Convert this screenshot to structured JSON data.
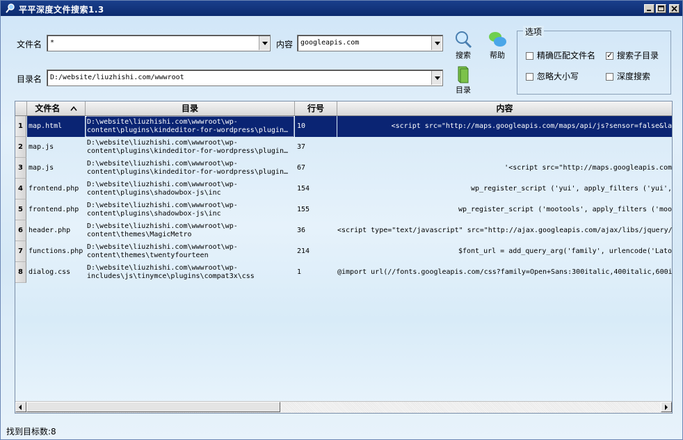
{
  "window": {
    "title": "平平深度文件搜索1.3"
  },
  "form": {
    "filename_label": "文件名",
    "filename_value": "*",
    "content_label": "内容",
    "content_value": "googleapis.com",
    "dir_label": "目录名",
    "dir_value": "D:/website/liuzhishi.com/wwwroot"
  },
  "toolbar": {
    "search_label": "搜索",
    "help_label": "帮助",
    "dir_label": "目录"
  },
  "options": {
    "title": "选项",
    "exact_match": {
      "label": "精确匹配文件名",
      "checked": false
    },
    "subdirs": {
      "label": "搜索子目录",
      "checked": true
    },
    "ignore_case": {
      "label": "忽略大小写",
      "checked": false
    },
    "deep_search": {
      "label": "深度搜索",
      "checked": false
    }
  },
  "table": {
    "columns": [
      "文件名",
      "目录",
      "行号",
      "内容"
    ],
    "rows": [
      {
        "num": "1",
        "name": "map.html",
        "dir1": "D:\\website\\liuzhishi.com\\wwwroot\\wp-",
        "dir2": "content\\plugins\\kindeditor-for-wordpress\\plugin…",
        "line": "10",
        "content": "<script src=\"http://maps.googleapis.com/maps/api/js?sensor=false&la",
        "selected": true
      },
      {
        "num": "2",
        "name": "map.js",
        "dir1": "D:\\website\\liuzhishi.com\\wwwroot\\wp-",
        "dir2": "content\\plugins\\kindeditor-for-wordpress\\plugin…",
        "line": "37",
        "content": "",
        "selected": false
      },
      {
        "num": "3",
        "name": "map.js",
        "dir1": "D:\\website\\liuzhishi.com\\wwwroot\\wp-",
        "dir2": "content\\plugins\\kindeditor-for-wordpress\\plugin…",
        "line": "67",
        "content": "'<script src=\"http://maps.googleapis.com",
        "selected": false
      },
      {
        "num": "4",
        "name": "frontend.php",
        "dir1": "D:\\website\\liuzhishi.com\\wwwroot\\wp-",
        "dir2": "content\\plugins\\shadowbox-js\\inc",
        "line": "154",
        "content": "wp_register_script ('yui', apply_filters ('yui',",
        "selected": false
      },
      {
        "num": "5",
        "name": "frontend.php",
        "dir1": "D:\\website\\liuzhishi.com\\wwwroot\\wp-",
        "dir2": "content\\plugins\\shadowbox-js\\inc",
        "line": "155",
        "content": "wp_register_script ('mootools', apply_filters ('moo",
        "selected": false
      },
      {
        "num": "6",
        "name": "header.php",
        "dir1": "D:\\website\\liuzhishi.com\\wwwroot\\wp-",
        "dir2": "content\\themes\\MagicMetro",
        "line": "36",
        "content": "<script type=\"text/javascript\" src=\"http://ajax.googleapis.com/ajax/libs/jquery/",
        "selected": false
      },
      {
        "num": "7",
        "name": "functions.php",
        "dir1": "D:\\website\\liuzhishi.com\\wwwroot\\wp-",
        "dir2": "content\\themes\\twentyfourteen",
        "line": "214",
        "content": "$font_url = add_query_arg('family', urlencode('Lato",
        "selected": false
      },
      {
        "num": "8",
        "name": "dialog.css",
        "dir1": "D:\\website\\liuzhishi.com\\wwwroot\\wp-",
        "dir2": "includes\\js\\tinymce\\plugins\\compat3x\\css",
        "line": "1",
        "content": "@import url(//fonts.googleapis.com/css?family=Open+Sans:300italic,400italic,600i",
        "selected": false
      }
    ]
  },
  "status": {
    "text": "找到目标数:8"
  }
}
